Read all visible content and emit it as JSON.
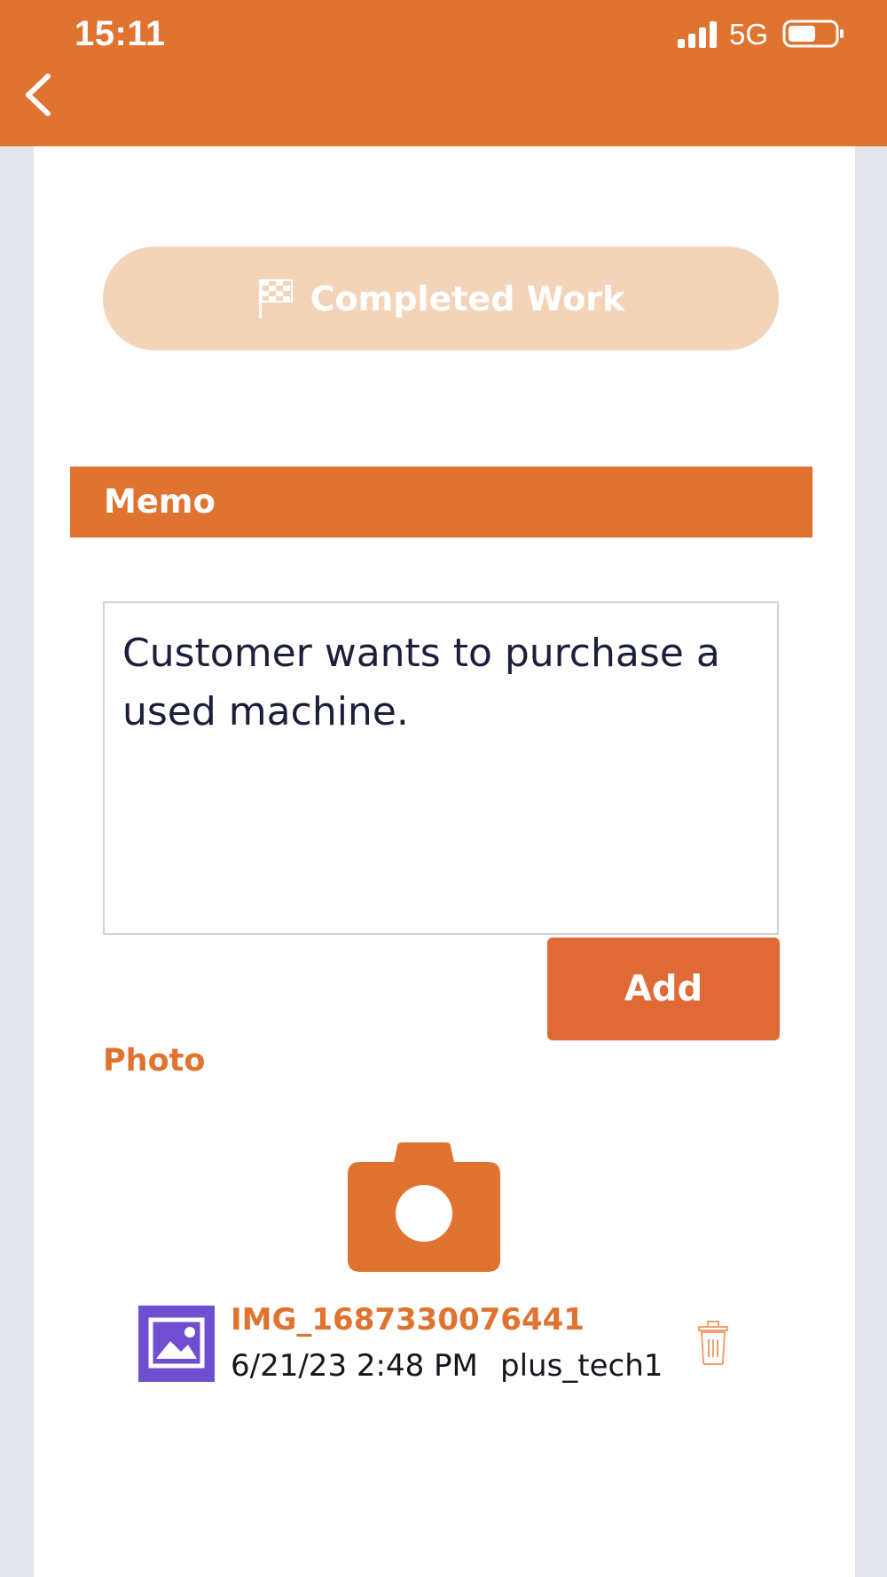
{
  "status_bar": {
    "time": "15:11",
    "network": "5G",
    "icons": [
      "signal-icon",
      "battery-icon"
    ]
  },
  "nav": {
    "back_icon": "chevron-left-icon"
  },
  "completed_button": {
    "label": "Completed Work",
    "icon": "checkered-flag-icon"
  },
  "memo": {
    "title": "Memo",
    "text": "Customer wants to purchase a used machine.",
    "add_label": "Add"
  },
  "photo": {
    "label": "Photo",
    "camera_icon": "camera-icon",
    "items": [
      {
        "name": "IMG_1687330076441",
        "date": "6/21/23 2:48 PM",
        "user": "plus_tech1",
        "thumb_icon": "image-icon",
        "delete_icon": "trash-icon"
      }
    ]
  },
  "colors": {
    "accent": "#e0732f",
    "completed_disabled": "#f4d4b9",
    "add_button": "#e06a35",
    "thumb": "#6f4fcf",
    "gutter": "#e2e6eb"
  }
}
